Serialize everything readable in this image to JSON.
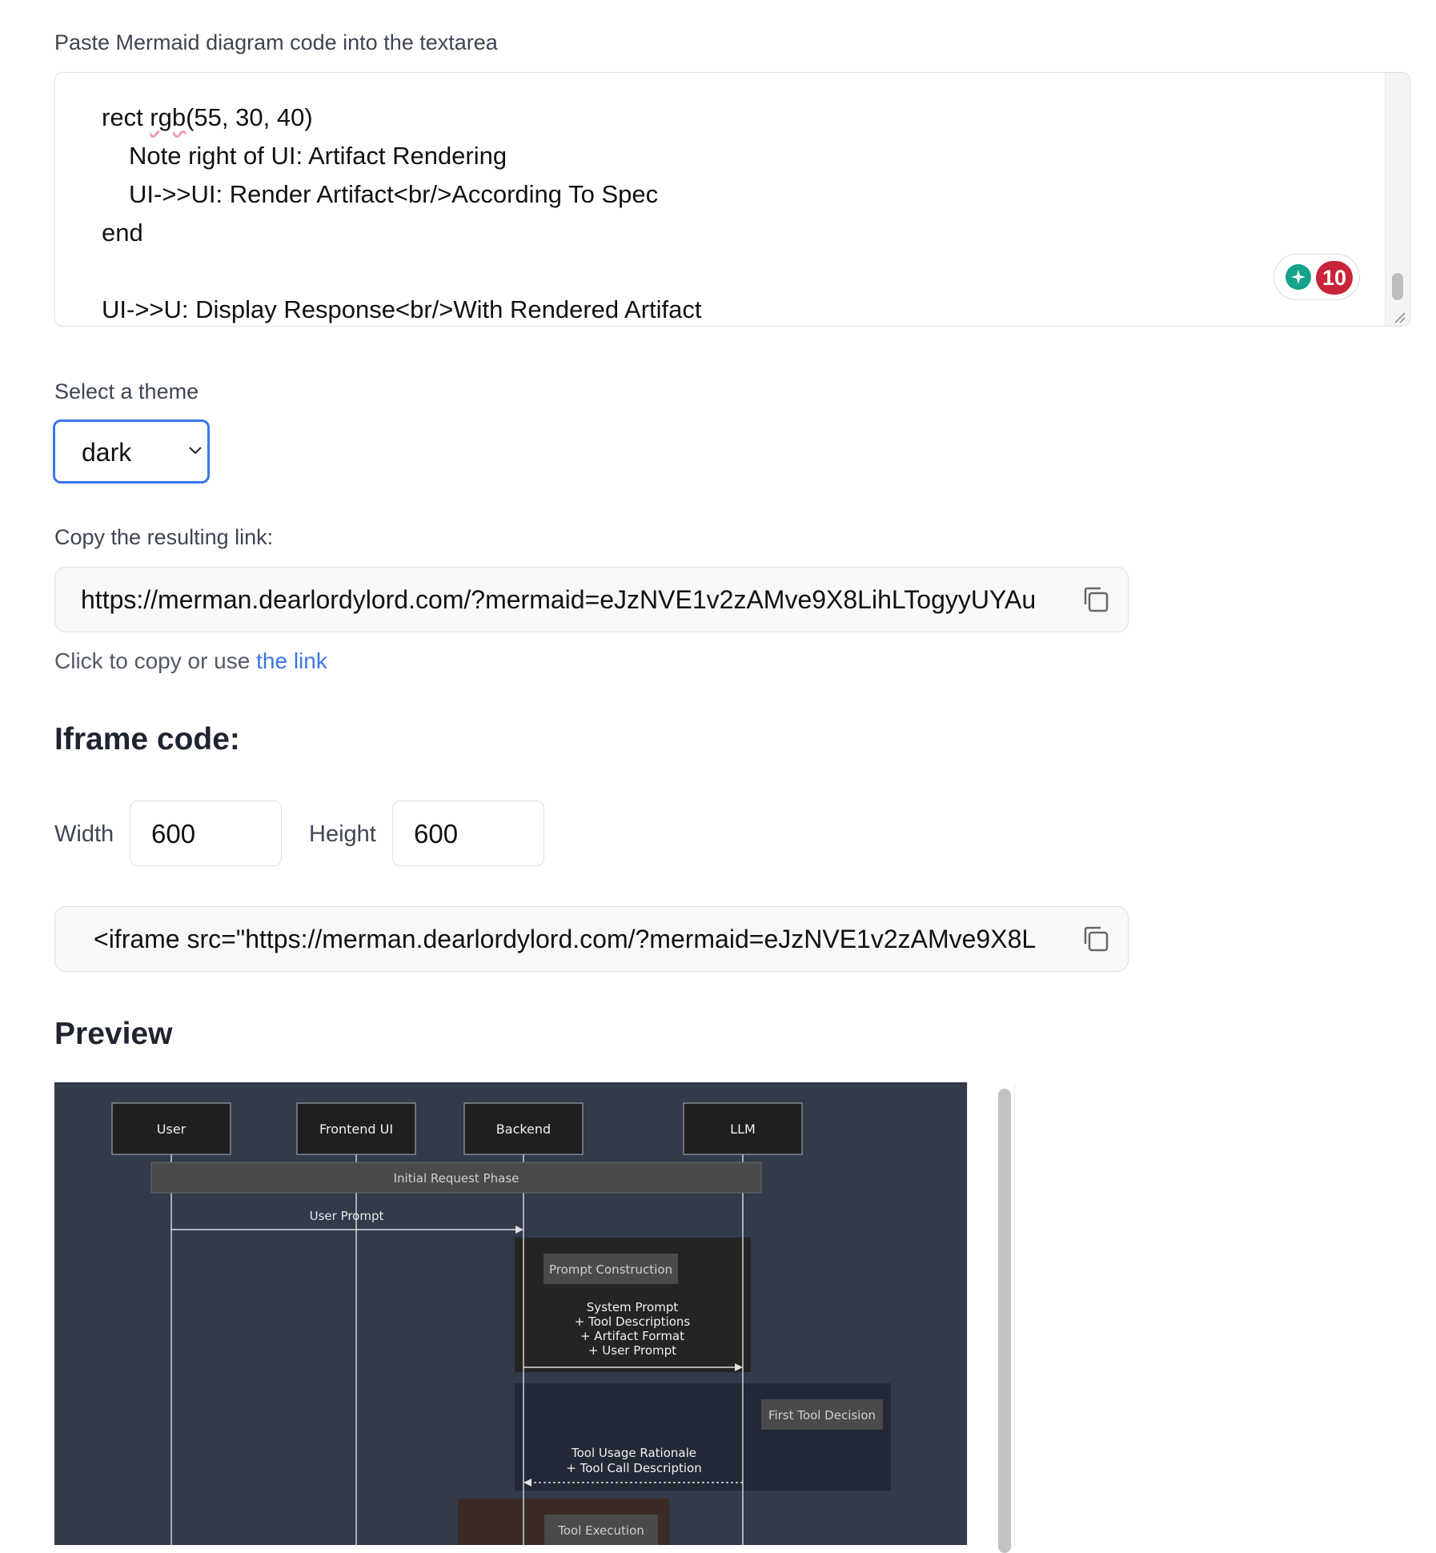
{
  "editor": {
    "label": "Paste Mermaid diagram code into the textarea",
    "lines": {
      "l1_pre": "rect ",
      "l1_word": "rgb",
      "l1_post": "(55, 30, 40)",
      "l2": "Note right of UI: Artifact Rendering",
      "l3": "UI->>UI: Render Artifact<br/>According To Spec",
      "l4": "end",
      "l5": "UI->>U: Display Response<br/>With Rendered Artifact"
    },
    "grammar_count": "10"
  },
  "theme": {
    "label": "Select a theme",
    "selected": "dark"
  },
  "link": {
    "label": "Copy the resulting link:",
    "url": "https://merman.dearlordylord.com/?mermaid=eJzNVE1v2zAMve9X8LihLTogyyUYAu",
    "hint_prefix": "Click to copy or use ",
    "hint_link": "the link"
  },
  "iframe": {
    "heading": "Iframe code:",
    "width_label": "Width",
    "width_value": "600",
    "height_label": "Height",
    "height_value": "600",
    "code": "<iframe src=\"https://merman.dearlordylord.com/?mermaid=eJzNVE1v2zAMve9X8L"
  },
  "preview": {
    "heading": "Preview",
    "participants": [
      "User",
      "Frontend UI",
      "Backend",
      "LLM"
    ],
    "notes": {
      "initial": "Initial Request Phase",
      "prompt_construction": "Prompt Construction",
      "first_tool": "First Tool Decision",
      "tool_exec": "Tool Execution"
    },
    "messages": {
      "user_prompt": "User Prompt",
      "sys1": "System Prompt",
      "sys2": "+ Tool Descriptions",
      "sys3": "+ Artifact Format",
      "sys4": "+ User Prompt",
      "rat1": "Tool Usage Rationale",
      "rat2": "+ Tool Call Description"
    }
  },
  "colors": {
    "accent": "#3b76e8",
    "preview_bg": "#333a4a",
    "badge": "#c8243a"
  }
}
